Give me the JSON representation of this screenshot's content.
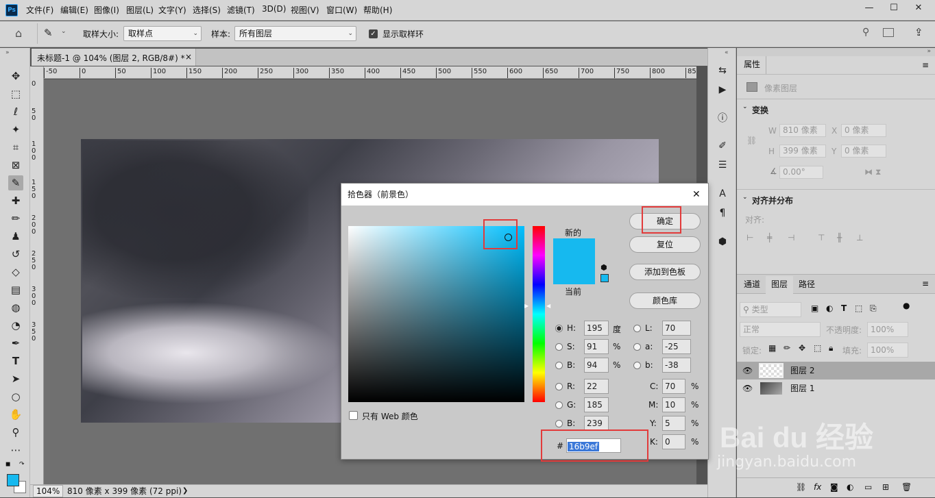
{
  "app": {
    "logo": "Ps"
  },
  "menus": [
    "文件(F)",
    "编辑(E)",
    "图像(I)",
    "图层(L)",
    "文字(Y)",
    "选择(S)",
    "滤镜(T)",
    "3D(D)",
    "视图(V)",
    "窗口(W)",
    "帮助(H)"
  ],
  "window_controls": [
    "—",
    "☐",
    "✕"
  ],
  "options": {
    "sample_size_label": "取样大小:",
    "sample_size_value": "取样点",
    "sample_label": "样本:",
    "sample_value": "所有图层",
    "show_ring_label": "显示取样环",
    "show_ring_checked": true
  },
  "document": {
    "tab_title": "未标题-1 @ 104% (图层 2, RGB/8#) *",
    "tab_close": "×",
    "ruler_h": [
      "-50",
      "0",
      "50",
      "100",
      "150",
      "200",
      "250",
      "300",
      "350",
      "400",
      "450",
      "500",
      "550",
      "600",
      "650",
      "700",
      "750",
      "800",
      "85"
    ],
    "ruler_v": [
      "0",
      "5",
      "0",
      "1",
      "0",
      "0",
      "1",
      "5",
      "0",
      "2",
      "0",
      "0",
      "2",
      "5",
      "0",
      "3",
      "0",
      "0",
      "3",
      "5",
      "0"
    ],
    "zoom": "104%",
    "status": "810 像素 x 399 像素 (72 ppi)",
    "status_arrow": "❯"
  },
  "properties": {
    "tab": "属性",
    "layer_type": "像素图层",
    "transform_title": "变换",
    "w_label": "W",
    "w_value": "810 像素",
    "x_label": "X",
    "x_value": "0 像素",
    "h_label": "H",
    "h_value": "399 像素",
    "y_label": "Y",
    "y_value": "0 像素",
    "angle_value": "0.00°",
    "align_title": "对齐并分布",
    "align_sub": "对齐:"
  },
  "layers_panel": {
    "tabs": [
      "通道",
      "图层",
      "路径"
    ],
    "active_tab": "图层",
    "filter_label": "类型",
    "blend_mode": "正常",
    "opacity_label": "不透明度:",
    "opacity_value": "100%",
    "lock_label": "锁定:",
    "fill_label": "填充:",
    "fill_value": "100%",
    "layers": [
      {
        "name": "图层 2",
        "selected": true
      },
      {
        "name": "图层 1",
        "selected": false
      }
    ],
    "footer_icons": [
      "link-icon",
      "fx-icon",
      "mask-icon",
      "adjustment-icon",
      "folder-icon",
      "new-layer-icon",
      "trash-icon"
    ]
  },
  "color_picker": {
    "title": "拾色器（前景色）",
    "close": "✕",
    "new_label": "新的",
    "current_label": "当前",
    "buttons": {
      "ok": "确定",
      "reset": "复位",
      "add_swatch": "添加到色板",
      "libraries": "颜色库"
    },
    "web_only_label": "只有 Web 颜色",
    "fields": {
      "H": {
        "label": "H:",
        "value": "195",
        "unit": "度"
      },
      "S": {
        "label": "S:",
        "value": "91",
        "unit": "%"
      },
      "B": {
        "label": "B:",
        "value": "94",
        "unit": "%"
      },
      "R": {
        "label": "R:",
        "value": "22"
      },
      "G": {
        "label": "G:",
        "value": "185"
      },
      "Bb": {
        "label": "B:",
        "value": "239"
      },
      "L": {
        "label": "L:",
        "value": "70"
      },
      "a": {
        "label": "a:",
        "value": "-25"
      },
      "b": {
        "label": "b:",
        "value": "-38"
      },
      "C": {
        "label": "C:",
        "value": "70",
        "unit": "%"
      },
      "M": {
        "label": "M:",
        "value": "10",
        "unit": "%"
      },
      "Y": {
        "label": "Y:",
        "value": "5",
        "unit": "%"
      },
      "K": {
        "label": "K:",
        "value": "0",
        "unit": "%"
      }
    },
    "hex_label": "#",
    "hex_value": "16b9ef",
    "colors": {
      "new": "#16b9ef",
      "current": "#16b9ef"
    }
  },
  "watermark": {
    "brand": "Bai du 经验",
    "url": "jingyan.baidu.com"
  }
}
